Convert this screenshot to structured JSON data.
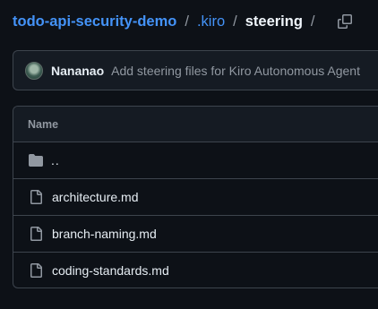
{
  "breadcrumb": {
    "repo": "todo-api-security-demo",
    "folder": ".kiro",
    "current": "steering",
    "separator": "/"
  },
  "commit": {
    "author": "Nananao",
    "message": "Add steering files for Kiro Autonomous Agent"
  },
  "table": {
    "header_name": "Name",
    "parent_dir": "..",
    "files": [
      {
        "name": "architecture.md",
        "icon": "file-icon"
      },
      {
        "name": "branch-naming.md",
        "icon": "file-icon"
      },
      {
        "name": "coding-standards.md",
        "icon": "file-icon"
      }
    ]
  },
  "colors": {
    "background": "#0d1117",
    "link": "#4493f8",
    "border": "#3d444d",
    "muted": "#9198a1"
  }
}
